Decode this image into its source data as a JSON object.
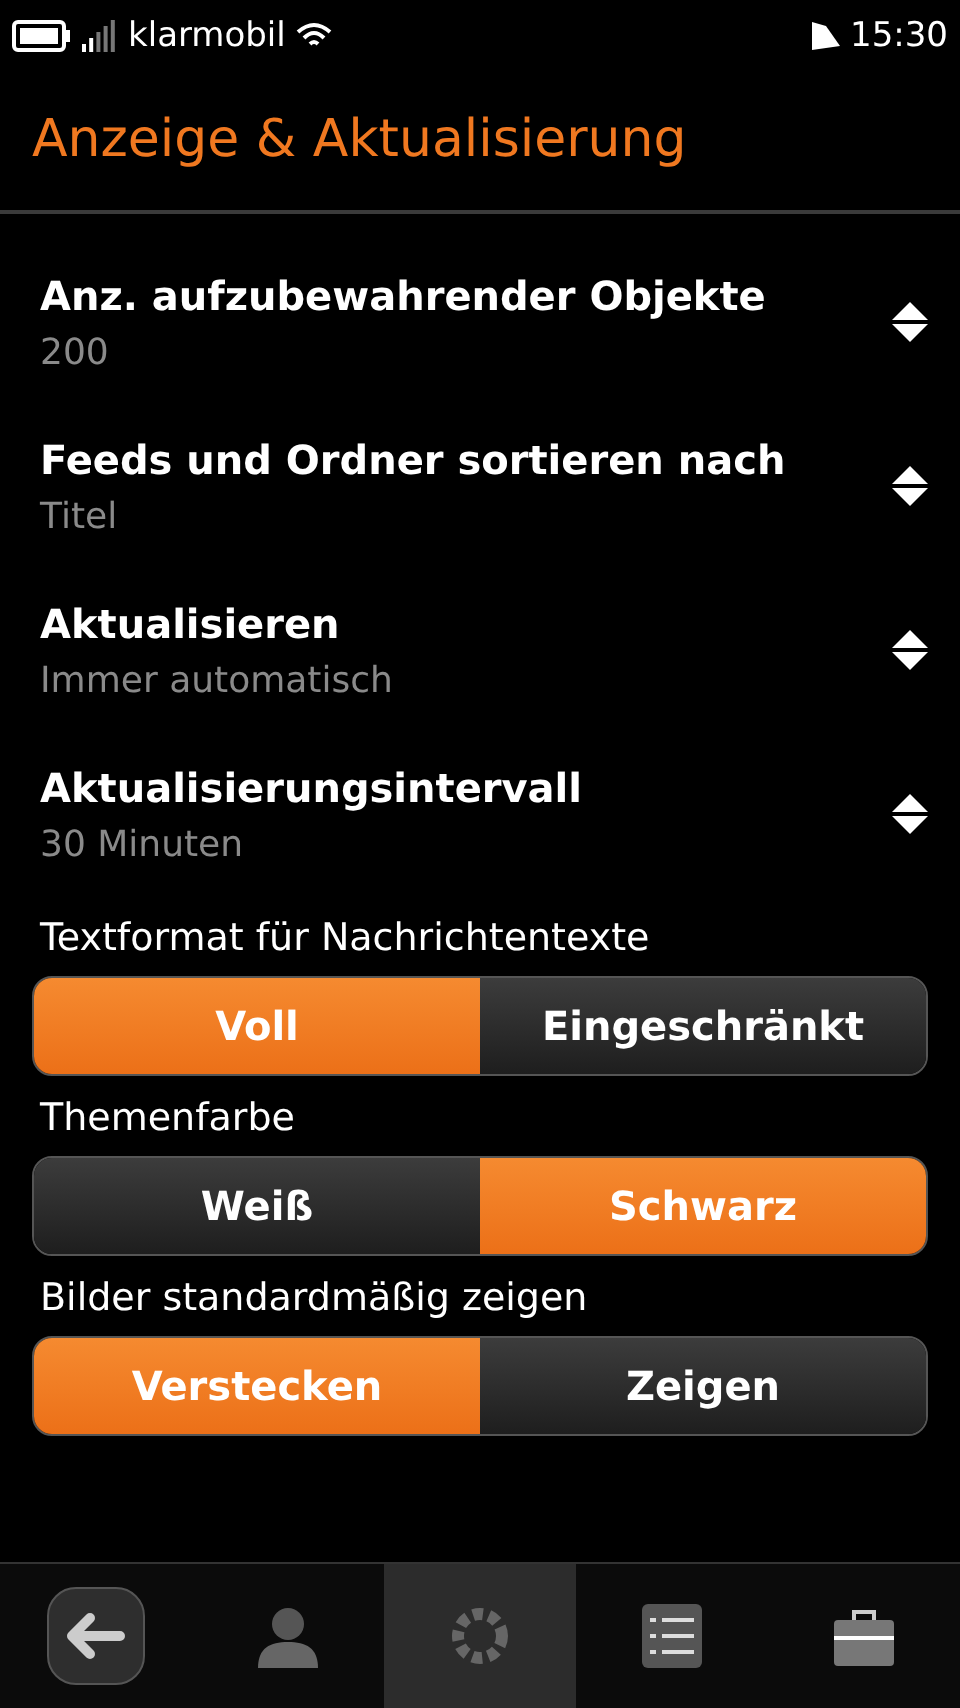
{
  "status_bar": {
    "carrier": "klarmobil",
    "time": "15:30"
  },
  "title": "Anzeige & Aktualisierung",
  "settings": [
    {
      "label": "Anz. aufzubewahrender Objekte",
      "value": "200"
    },
    {
      "label": "Feeds und Ordner sortieren nach",
      "value": "Titel"
    },
    {
      "label": "Aktualisieren",
      "value": "Immer automatisch"
    },
    {
      "label": "Aktualisierungsintervall",
      "value": "30 Minuten"
    }
  ],
  "segments": [
    {
      "label": "Textformat für Nachrichtentexte",
      "options": [
        {
          "label": "Voll",
          "selected": true
        },
        {
          "label": "Eingeschränkt",
          "selected": false
        }
      ]
    },
    {
      "label": "Themenfarbe",
      "options": [
        {
          "label": "Weiß",
          "selected": false
        },
        {
          "label": "Schwarz",
          "selected": true
        }
      ]
    },
    {
      "label": "Bilder standardmäßig zeigen",
      "options": [
        {
          "label": "Verstecken",
          "selected": true
        },
        {
          "label": "Zeigen",
          "selected": false
        }
      ]
    }
  ],
  "toolbar": [
    {
      "kind": "back",
      "selected": false
    },
    {
      "kind": "person",
      "selected": false
    },
    {
      "kind": "gear",
      "selected": true
    },
    {
      "kind": "list",
      "selected": false
    },
    {
      "kind": "briefcase",
      "selected": false
    }
  ]
}
